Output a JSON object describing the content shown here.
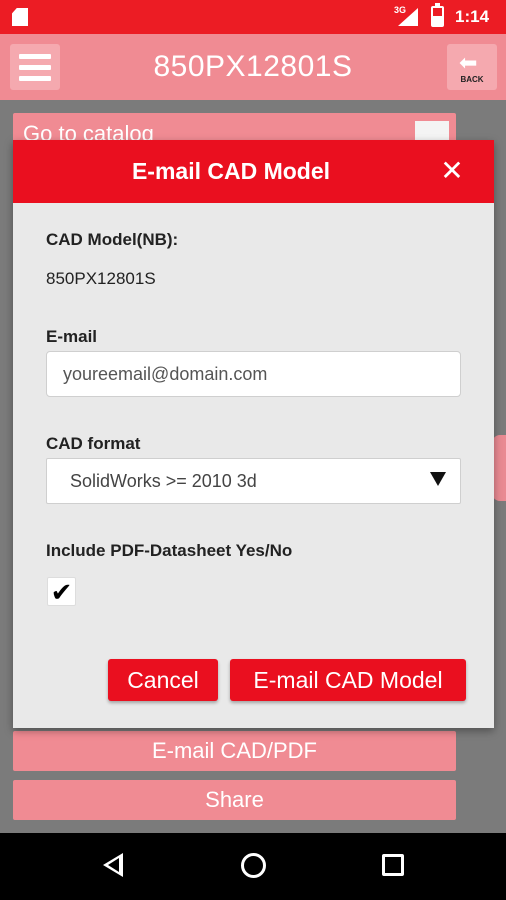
{
  "status_bar": {
    "network": "3G",
    "time": "1:14"
  },
  "app_bar": {
    "title": "850PX12801S",
    "back_label": "BACK"
  },
  "background": {
    "goto_catalog": "Go to catalog",
    "email_cad_pdf": "E-mail CAD/PDF",
    "share": "Share"
  },
  "dialog": {
    "title": "E-mail CAD Model",
    "close_symbol": "✕",
    "model_label": "CAD Model(NB):",
    "model_value": "850PX12801S",
    "email_label": "E-mail",
    "email_placeholder": "youreemail@domain.com",
    "format_label": "CAD format",
    "format_value": "SolidWorks >= 2010 3d",
    "pdf_label": "Include PDF-Datasheet Yes/No",
    "pdf_checked": true,
    "check_symbol": "✔",
    "cancel_label": "Cancel",
    "send_label": "E-mail CAD Model"
  },
  "colors": {
    "accent": "#ea0f1f",
    "accent_dimmed": "#f08b93"
  }
}
